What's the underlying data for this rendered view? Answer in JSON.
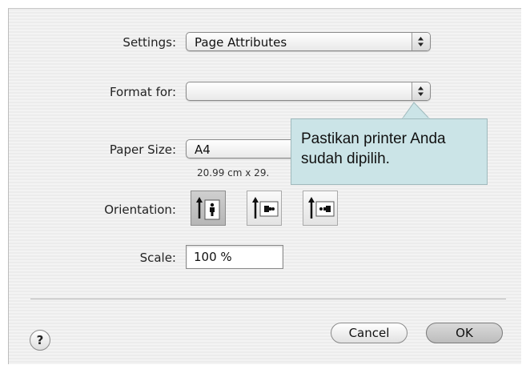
{
  "settings": {
    "label": "Settings:",
    "value": "Page Attributes"
  },
  "format_for": {
    "label": "Format for:",
    "value": ""
  },
  "paper_size": {
    "label": "Paper Size:",
    "value": "A4",
    "dimensions": "20.99 cm x 29."
  },
  "orientation": {
    "label": "Orientation:",
    "options": [
      "portrait",
      "landscape-left",
      "landscape-right"
    ],
    "selected": "portrait"
  },
  "scale": {
    "label": "Scale:",
    "value": "100 %"
  },
  "buttons": {
    "help": "?",
    "cancel": "Cancel",
    "ok": "OK"
  },
  "callout": {
    "line1": "Pastikan printer Anda",
    "line2": "sudah dipilih.",
    "color": "#cbe4e7"
  }
}
